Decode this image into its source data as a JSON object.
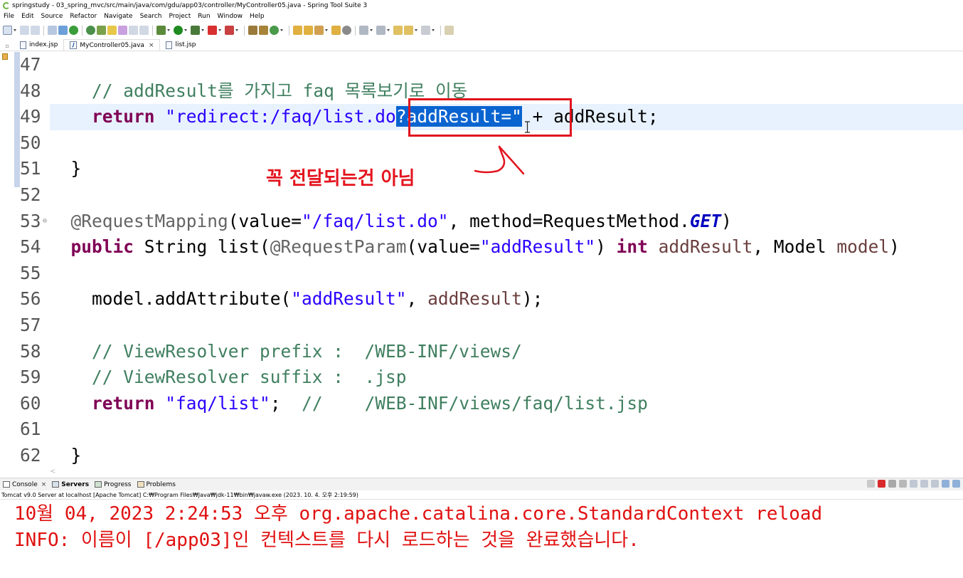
{
  "window": {
    "title": "springstudy - 03_spring_mvc/src/main/java/com/gdu/app03/controller/MyController05.java - Spring Tool Suite 3"
  },
  "menu": [
    "File",
    "Edit",
    "Source",
    "Refactor",
    "Navigate",
    "Search",
    "Project",
    "Run",
    "Window",
    "Help"
  ],
  "editor_tabs": [
    {
      "label": "index.jsp",
      "icon": "jsp-file-icon",
      "active": false
    },
    {
      "label": "MyController05.java",
      "icon": "java-file-icon",
      "active": true,
      "close": "×"
    },
    {
      "label": "list.jsp",
      "icon": "jsp-file-icon",
      "active": false
    }
  ],
  "editor": {
    "line_numbers": [
      "47",
      "48",
      "49",
      "50",
      "51",
      "52",
      "53",
      "54",
      "55",
      "56",
      "57",
      "58",
      "59",
      "60",
      "61",
      "62"
    ],
    "lines": {
      "l48": {
        "comment": "// addResult를 가지고 faq 목록보기로 이동"
      },
      "l49": {
        "kw": "return",
        "str_a": "\"redirect:/faq/list.do",
        "sel": "?addResult=\"",
        "rest": " + addResult;"
      },
      "l51": {
        "text": "}"
      },
      "l53": {
        "ann": "@RequestMapping",
        "p1": "(value=",
        "str": "\"/faq/list.do\"",
        "p2": ", method=RequestMethod.",
        "fld": "GET",
        "p3": ")"
      },
      "l54": {
        "kw": "public",
        "p1": " String list(",
        "ann": "@RequestParam",
        "p2": "(value=",
        "str": "\"addResult\"",
        "p3": ") ",
        "kw2": "int",
        "var": " addResult",
        "p4": ", Model ",
        "var2": "model",
        "p5": ")"
      },
      "l56": {
        "p1": "model.addAttribute(",
        "str": "\"addResult\"",
        "p2": ", ",
        "var": "addResult",
        "p3": ");"
      },
      "l58": {
        "comment": "// ViewResolver prefix :  /WEB-INF/views/"
      },
      "l59": {
        "comment": "// ViewResolver suffix :  .jsp"
      },
      "l60": {
        "kw": "return",
        "str": "\"faq/list\"",
        "p1": ";  ",
        "comment": "//    /WEB-INF/views/faq/list.jsp"
      },
      "l62": {
        "text": "}"
      }
    }
  },
  "annotation": {
    "text": "꼭 전달되는건 아님",
    "color": "#e3141e"
  },
  "console": {
    "tabs": [
      {
        "label": "Console",
        "icon": "console-icon",
        "close": "×"
      },
      {
        "label": "Servers",
        "icon": "servers-icon",
        "bold": true
      },
      {
        "label": "Progress",
        "icon": "progress-icon"
      },
      {
        "label": "Problems",
        "icon": "problems-icon"
      }
    ],
    "description": "Tomcat v9.0 Server at localhost [Apache Tomcat] C:₩Program Files₩Java₩jdk-11₩bin₩javaw.exe  (2023. 10. 4. 오후 2:19:59)",
    "output": [
      "10월 04, 2023 2:24:53 오후 org.apache.catalina.core.StandardContext reload",
      "INFO: 이름이 [/app03]인 컨텍스트를 다시 로드하는 것을 완료했습니다."
    ]
  }
}
